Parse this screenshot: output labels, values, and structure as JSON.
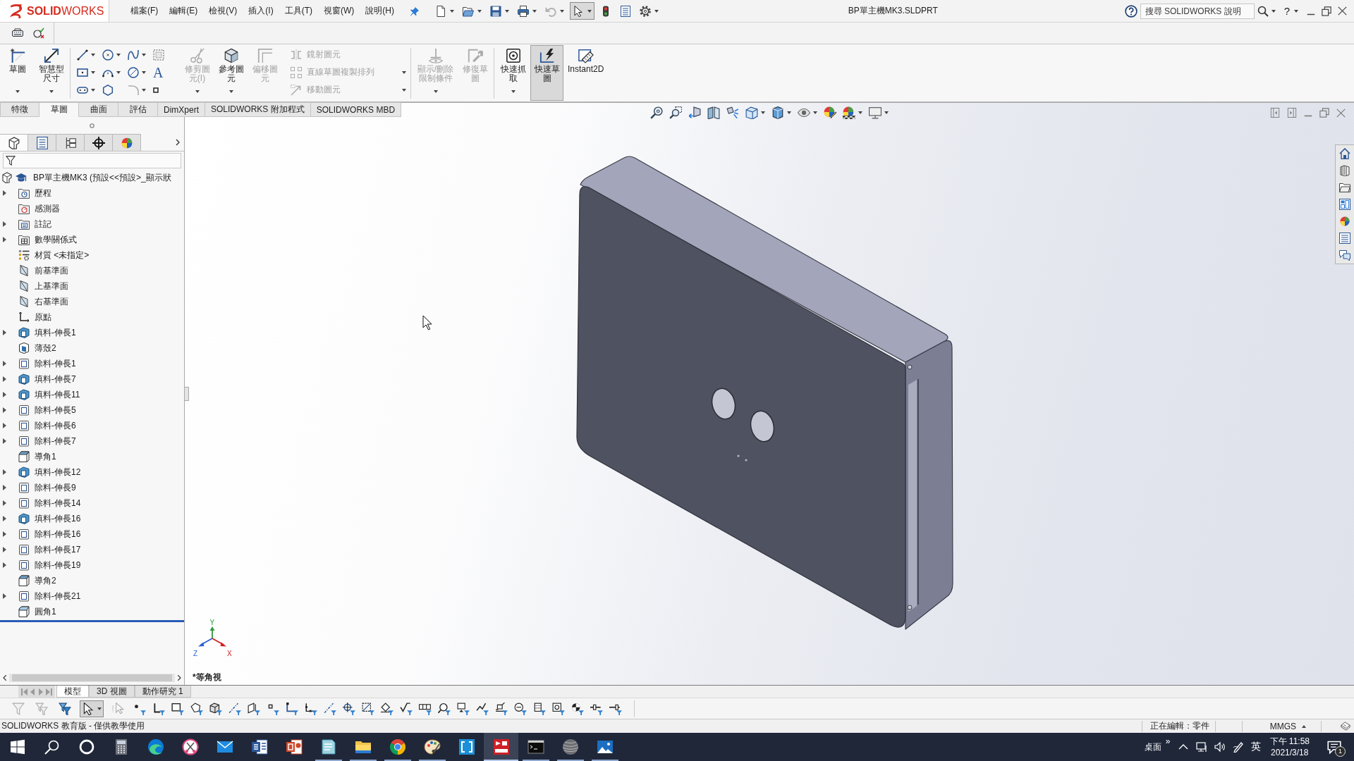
{
  "title_bar": {
    "logo": "**SOLID**WORKS",
    "menu": [
      "檔案(F)",
      "編輯(E)",
      "檢視(V)",
      "插入(I)",
      "工具(T)",
      "視窗(W)",
      "說明(H)"
    ],
    "quick_access": [
      {
        "kind": "new",
        "dropdown": true,
        "disabled": false,
        "pressed": false
      },
      {
        "kind": "open",
        "dropdown": true,
        "disabled": false,
        "pressed": false
      },
      {
        "kind": "save",
        "dropdown": true,
        "disabled": false,
        "pressed": false
      },
      {
        "kind": "print",
        "dropdown": true,
        "disabled": false,
        "pressed": false
      },
      {
        "kind": "undo",
        "dropdown": true,
        "disabled": true,
        "pressed": false
      },
      {
        "kind": "select",
        "dropdown": true,
        "disabled": false,
        "pressed": true
      },
      {
        "kind": "rebuild",
        "dropdown": false,
        "disabled": false,
        "pressed": false
      },
      {
        "kind": "properties",
        "dropdown": false,
        "disabled": false,
        "pressed": false
      },
      {
        "kind": "options",
        "dropdown": true,
        "disabled": false,
        "pressed": false
      }
    ],
    "document_title": "BP單主機MK3.SLDPRT",
    "search": {
      "placeholder": "搜尋 SOLIDWORKS 說明"
    },
    "help": "?"
  },
  "ribbon": {
    "groups": [
      {
        "kind": "large",
        "separator": true,
        "buttons": [
          {
            "kind": "sketch",
            "label": "草圖",
            "dropdown": true,
            "disabled": false,
            "selected": false
          },
          {
            "kind": "smart_dimension",
            "label": "智慧型尺寸",
            "dropdown": true,
            "disabled": false,
            "selected": false
          }
        ]
      },
      {
        "kind": "grid",
        "separator": false,
        "tools": [
          {
            "kind": "line",
            "dropdown": true,
            "disabled": false
          },
          {
            "kind": "circle",
            "dropdown": true,
            "disabled": false
          },
          {
            "kind": "spline",
            "dropdown": true,
            "disabled": false
          },
          {
            "kind": "sketch_picture",
            "dropdown": false,
            "disabled": false
          },
          {
            "kind": "rectangle",
            "dropdown": true,
            "disabled": false
          },
          {
            "kind": "arc",
            "dropdown": true,
            "disabled": false
          },
          {
            "kind": "perimeter_circle",
            "dropdown": true,
            "disabled": false
          },
          {
            "kind": "text",
            "glyph": "A",
            "dropdown": false,
            "disabled": false
          },
          {
            "kind": "slot",
            "dropdown": true,
            "disabled": false
          },
          {
            "kind": "polygon",
            "dropdown": false,
            "disabled": false
          },
          {
            "kind": "fillet",
            "dropdown": true,
            "disabled": true
          },
          {
            "kind": "point",
            "dropdown": false,
            "disabled": false
          }
        ]
      },
      {
        "kind": "large",
        "separator": false,
        "buttons": [
          {
            "kind": "trim",
            "label": "修剪圖元(I)",
            "dropdown": true,
            "disabled": true,
            "selected": false
          },
          {
            "kind": "convert",
            "label": "參考圖元",
            "dropdown": true,
            "disabled": false,
            "selected": false
          },
          {
            "kind": "offset",
            "label": "偏移圖元",
            "dropdown": false,
            "disabled": true,
            "selected": false
          }
        ]
      },
      {
        "kind": "list",
        "separator": true,
        "tools": [
          {
            "kind": "mirror",
            "label": "鏡射圖元",
            "dropdown": false,
            "disabled": true
          },
          {
            "kind": "pattern",
            "label": "直線草圖複製排列",
            "dropdown": true,
            "disabled": true
          },
          {
            "kind": "move",
            "label": "移動圖元",
            "dropdown": true,
            "disabled": true
          }
        ]
      },
      {
        "kind": "large",
        "separator": true,
        "buttons": [
          {
            "kind": "relations",
            "label": "顯示/刪除限制條件",
            "dropdown": true,
            "disabled": true,
            "selected": false
          },
          {
            "kind": "repair",
            "label": "修復草圖",
            "dropdown": false,
            "disabled": true,
            "selected": false
          }
        ]
      },
      {
        "kind": "large",
        "separator": false,
        "buttons": [
          {
            "kind": "snaps",
            "label": "快速抓取",
            "dropdown": true,
            "disabled": false,
            "selected": false
          },
          {
            "kind": "rapid_sketch",
            "label": "快速草圖",
            "dropdown": false,
            "disabled": false,
            "selected": true
          },
          {
            "kind": "instant2d",
            "label": "Instant2D",
            "dropdown": false,
            "disabled": false,
            "selected": false
          }
        ]
      }
    ]
  },
  "command_tabs": [
    {
      "label": "特徵",
      "selected": false
    },
    {
      "label": "草圖",
      "selected": true
    },
    {
      "label": "曲面",
      "selected": false
    },
    {
      "label": "評估",
      "selected": false
    },
    {
      "label": "DimXpert",
      "selected": false
    },
    {
      "label": "SOLIDWORKS 附加程式",
      "selected": false
    },
    {
      "label": "SOLIDWORKS MBD",
      "selected": false
    }
  ],
  "feature_manager": {
    "tabs": [
      {
        "kind": "feature_tree",
        "selected": true
      },
      {
        "kind": "property",
        "selected": false
      },
      {
        "kind": "config",
        "selected": false
      },
      {
        "kind": "dimxpert",
        "selected": false
      },
      {
        "kind": "display",
        "selected": false
      }
    ],
    "root": {
      "label": "BP單主機MK3 (預設<<預設>_顯示狀"
    },
    "items": [
      {
        "label": "歷程",
        "kind": "history",
        "expandable": true
      },
      {
        "label": "感測器",
        "kind": "sensor",
        "expandable": false
      },
      {
        "label": "註記",
        "kind": "annotations",
        "expandable": true
      },
      {
        "label": "數學關係式",
        "kind": "equations",
        "expandable": true
      },
      {
        "label": "材質 <未指定>",
        "kind": "material",
        "expandable": false
      },
      {
        "label": "前基準面",
        "kind": "plane",
        "expandable": false
      },
      {
        "label": "上基準面",
        "kind": "plane",
        "expandable": false
      },
      {
        "label": "右基準面",
        "kind": "plane",
        "expandable": false
      },
      {
        "label": "原點",
        "kind": "origin",
        "expandable": false
      },
      {
        "label": "填料-伸長1",
        "kind": "boss",
        "expandable": true
      },
      {
        "label": "薄殼2",
        "kind": "shell",
        "expandable": false
      },
      {
        "label": "除料-伸長1",
        "kind": "cut",
        "expandable": true
      },
      {
        "label": "填料-伸長7",
        "kind": "boss",
        "expandable": true
      },
      {
        "label": "填料-伸長11",
        "kind": "boss",
        "expandable": true
      },
      {
        "label": "除料-伸長5",
        "kind": "cut",
        "expandable": true
      },
      {
        "label": "除料-伸長6",
        "kind": "cut",
        "expandable": true
      },
      {
        "label": "除料-伸長7",
        "kind": "cut",
        "expandable": true
      },
      {
        "label": "導角1",
        "kind": "chamfer",
        "expandable": false
      },
      {
        "label": "填料-伸長12",
        "kind": "boss",
        "expandable": true
      },
      {
        "label": "除料-伸長9",
        "kind": "cut",
        "expandable": true
      },
      {
        "label": "除料-伸長14",
        "kind": "cut",
        "expandable": true
      },
      {
        "label": "填料-伸長16",
        "kind": "boss",
        "expandable": true
      },
      {
        "label": "除料-伸長16",
        "kind": "cut",
        "expandable": true
      },
      {
        "label": "除料-伸長17",
        "kind": "cut",
        "expandable": true
      },
      {
        "label": "除料-伸長19",
        "kind": "cut",
        "expandable": true
      },
      {
        "label": "導角2",
        "kind": "chamfer",
        "expandable": false
      },
      {
        "label": "除料-伸長21",
        "kind": "cut",
        "expandable": true
      },
      {
        "label": "圓角1",
        "kind": "fillet",
        "expandable": false
      }
    ]
  },
  "graphics": {
    "view_tools": [
      {
        "kind": "zoom_fit",
        "dropdown": false
      },
      {
        "kind": "zoom_area",
        "dropdown": false
      },
      {
        "kind": "previous_view",
        "dropdown": false
      },
      {
        "kind": "section_view",
        "dropdown": false
      },
      {
        "kind": "dynamic_annotation",
        "dropdown": false
      },
      {
        "kind": "view_orientation",
        "dropdown": true
      },
      {
        "kind": "display_style",
        "dropdown": true
      },
      {
        "kind": "hide_show",
        "dropdown": true
      },
      {
        "kind": "edit_appearance",
        "dropdown": false
      },
      {
        "kind": "apply_scene",
        "dropdown": true
      },
      {
        "kind": "view_settings",
        "dropdown": true
      }
    ],
    "triad": {
      "x": "X",
      "y": "Y",
      "z": "Z"
    },
    "view_name": "*等角視"
  },
  "bottom_tabs": [
    {
      "label": "模型",
      "selected": true
    },
    {
      "label": "3D 視圖",
      "selected": false
    },
    {
      "label": "動作研究 1",
      "selected": false
    }
  ],
  "selection_toolbar": {
    "tools": [
      {
        "kind": "filter_toggle",
        "disabled": true,
        "pressed": false
      },
      {
        "kind": "filter_clear",
        "disabled": true,
        "pressed": false
      },
      {
        "kind": "filter_all",
        "disabled": false,
        "pressed": false
      },
      {
        "kind": "select",
        "disabled": false,
        "pressed": true
      },
      {
        "kind": "select_other",
        "disabled": true,
        "pressed": false
      }
    ],
    "filters": [
      {
        "kind": "vertex"
      },
      {
        "kind": "edge"
      },
      {
        "kind": "face"
      },
      {
        "kind": "surface_body"
      },
      {
        "kind": "solid_body"
      },
      {
        "kind": "axis"
      },
      {
        "kind": "plane"
      },
      {
        "kind": "sketch_point"
      },
      {
        "kind": "sketch_segment"
      },
      {
        "kind": "midpoint"
      },
      {
        "kind": "axis"
      },
      {
        "kind": "center_mark"
      },
      {
        "kind": "centerline"
      },
      {
        "kind": "dimension"
      },
      {
        "kind": "surface_finish"
      },
      {
        "kind": "tolerance"
      },
      {
        "kind": "note"
      },
      {
        "kind": "datum"
      },
      {
        "kind": "weld"
      },
      {
        "kind": "datum_target"
      },
      {
        "kind": "hole_callout"
      },
      {
        "kind": "thread"
      },
      {
        "kind": "block"
      },
      {
        "kind": "center_of_mass"
      },
      {
        "kind": "connection_point"
      },
      {
        "kind": "routing_point"
      }
    ]
  },
  "status_bar": {
    "message": "SOLIDWORKS 教育版 - 僅供教學使用",
    "editing": "正在編輯：零件",
    "units": "MMGS"
  },
  "taskbar": {
    "apps": [
      {
        "kind": "start",
        "running": false,
        "active": false
      },
      {
        "kind": "search",
        "running": false,
        "active": false
      },
      {
        "kind": "cortana",
        "running": false,
        "active": false
      },
      {
        "kind": "calculator",
        "running": false,
        "active": false
      },
      {
        "kind": "edge",
        "running": false,
        "active": false
      },
      {
        "kind": "snip",
        "running": false,
        "active": false
      },
      {
        "kind": "mail",
        "running": false,
        "active": false
      },
      {
        "kind": "word",
        "running": false,
        "active": false
      },
      {
        "kind": "powerpoint",
        "running": false,
        "active": false
      },
      {
        "kind": "notes",
        "running": true,
        "active": false
      },
      {
        "kind": "explorer",
        "running": true,
        "active": false
      },
      {
        "kind": "chrome",
        "running": true,
        "active": false
      },
      {
        "kind": "paint",
        "running": true,
        "active": false
      },
      {
        "kind": "brackets",
        "running": false,
        "active": false
      },
      {
        "kind": "solidworks",
        "running": true,
        "active": true
      },
      {
        "kind": "terminal",
        "running": true,
        "active": false
      },
      {
        "kind": "sphere",
        "running": true,
        "active": false
      },
      {
        "kind": "photos",
        "running": true,
        "active": false
      }
    ],
    "tray": {
      "desktop": "桌面",
      "more": "»",
      "ime": "英",
      "time": "下午 11:58",
      "date": "2021/3/18",
      "notifications": "1"
    }
  }
}
